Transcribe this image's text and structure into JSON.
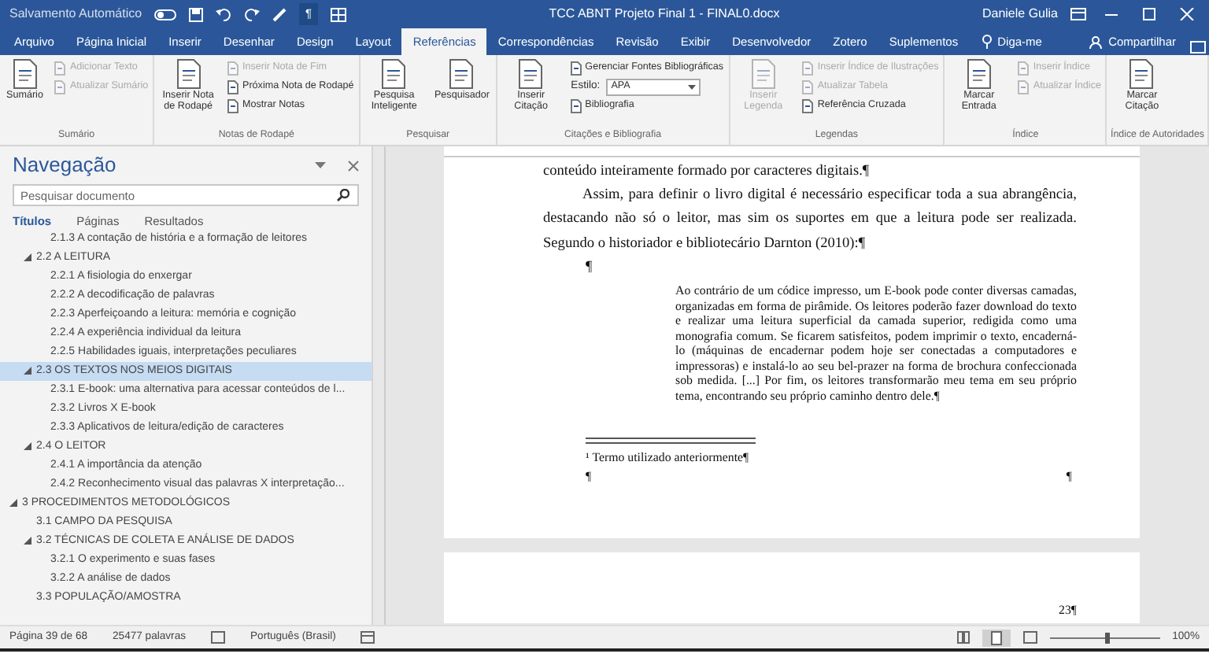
{
  "title_bar": {
    "autosave_label": "Salvamento Automático",
    "pilcrow": "¶",
    "title": "TCC ABNT Projeto Final 1 - FINAL0.docx",
    "user": "Daniele Gulia"
  },
  "ribbon_tabs": [
    {
      "label": "Arquivo",
      "selected": false
    },
    {
      "label": "Página Inicial",
      "selected": false
    },
    {
      "label": "Inserir",
      "selected": false
    },
    {
      "label": "Desenhar",
      "selected": false
    },
    {
      "label": "Design",
      "selected": false
    },
    {
      "label": "Layout",
      "selected": false
    },
    {
      "label": "Referências",
      "selected": true
    },
    {
      "label": "Correspondências",
      "selected": false
    },
    {
      "label": "Revisão",
      "selected": false
    },
    {
      "label": "Exibir",
      "selected": false
    },
    {
      "label": "Desenvolvedor",
      "selected": false
    },
    {
      "label": "Zotero",
      "selected": false
    },
    {
      "label": "Suplementos",
      "selected": false
    }
  ],
  "tell_me": "Diga-me",
  "share": "Compartilhar",
  "ribbon_groups": [
    {
      "name": "Sumário",
      "items": [
        {
          "kind": "large",
          "label": "Sumário",
          "disabled": false
        },
        {
          "kind": "small",
          "label": "Adicionar Texto",
          "disabled": true
        },
        {
          "kind": "small",
          "label": "Atualizar Sumário",
          "disabled": true
        }
      ]
    },
    {
      "name": "Notas de Rodapé",
      "items": [
        {
          "kind": "large",
          "label": "Inserir Nota de Rodapé",
          "disabled": false
        },
        {
          "kind": "small",
          "label": "Inserir Nota de Fim",
          "disabled": true
        },
        {
          "kind": "small",
          "label": "Próxima Nota de Rodapé",
          "disabled": false
        },
        {
          "kind": "small",
          "label": "Mostrar Notas",
          "disabled": false
        }
      ]
    },
    {
      "name": "Pesquisar",
      "items": [
        {
          "kind": "large",
          "label": "Pesquisa Inteligente",
          "disabled": false
        },
        {
          "kind": "large",
          "label": "Pesquisador",
          "disabled": false
        }
      ]
    },
    {
      "name": "Citações e Bibliografia",
      "items": [
        {
          "kind": "large",
          "label": "Inserir Citação",
          "disabled": false
        },
        {
          "kind": "small",
          "label": "Gerenciar Fontes Bibliográficas",
          "disabled": false
        },
        {
          "kind": "select",
          "label": "Estilo:",
          "value": "APA",
          "disabled": false
        },
        {
          "kind": "small",
          "label": "Bibliografia",
          "disabled": false
        }
      ]
    },
    {
      "name": "Legendas",
      "items": [
        {
          "kind": "large",
          "label": "Inserir Legenda",
          "disabled": true
        },
        {
          "kind": "small",
          "label": "Inserir Índice de Ilustrações",
          "disabled": true
        },
        {
          "kind": "small",
          "label": "Atualizar Tabela",
          "disabled": true
        },
        {
          "kind": "small",
          "label": "Referência Cruzada",
          "disabled": false
        }
      ]
    },
    {
      "name": "Índice",
      "items": [
        {
          "kind": "large",
          "label": "Marcar Entrada",
          "disabled": false
        },
        {
          "kind": "small",
          "label": "Inserir Índice",
          "disabled": true
        },
        {
          "kind": "small",
          "label": "Atualizar Índice",
          "disabled": true
        }
      ]
    },
    {
      "name": "Índice de Autoridades",
      "items": [
        {
          "kind": "large",
          "label": "Marcar Citação",
          "disabled": false
        }
      ]
    }
  ],
  "navigation": {
    "title": "Navegação",
    "search": {
      "placeholder": "Pesquisar documento"
    },
    "tabs": [
      {
        "label": "Títulos",
        "selected": true
      },
      {
        "label": "Páginas",
        "selected": false
      },
      {
        "label": "Resultados",
        "selected": false
      }
    ],
    "tree": [
      {
        "children": [
          {
            "children": [
              {
                "label": "2.1.3 A contação de história e a formação de leitores",
                "selected": false
              }
            ]
          },
          {
            "label": "2.2 A LEITURA",
            "selected": false,
            "expanded": true,
            "children": [
              {
                "label": "2.2.1 A fisiologia do enxergar",
                "selected": false
              },
              {
                "label": "2.2.2 A decodificação de palavras",
                "selected": false
              },
              {
                "label": "2.2.3 Aperfeiçoando a leitura: memória e cognição",
                "selected": false
              },
              {
                "label": "2.2.4 A experiência individual da leitura",
                "selected": false
              },
              {
                "label": "2.2.5 Habilidades iguais, interpretações peculiares",
                "selected": false
              }
            ]
          },
          {
            "label": "2.3 OS TEXTOS NOS MEIOS DIGITAIS",
            "selected": true,
            "expanded": true,
            "children": [
              {
                "label": "2.3.1 E-book: uma alternativa para acessar conteúdos de l...",
                "selected": false
              },
              {
                "label": "2.3.2 Livros X E-book",
                "selected": false
              },
              {
                "label": "2.3.3 Aplicativos de leitura/edição de caracteres",
                "selected": false
              }
            ]
          },
          {
            "label": "2.4 O LEITOR",
            "selected": false,
            "expanded": true,
            "children": [
              {
                "label": "2.4.1 A importância da atenção",
                "selected": false
              },
              {
                "label": "2.4.2 Reconhecimento visual das palavras X interpretação...",
                "selected": false
              }
            ]
          }
        ]
      },
      {
        "label": "3 PROCEDIMENTOS METODOLÓGICOS",
        "selected": false,
        "expanded": true,
        "children": [
          {
            "label": "3.1 CAMPO DA PESQUISA",
            "selected": false
          },
          {
            "label": "3.2 TÉCNICAS DE COLETA E ANÁLISE DE DADOS",
            "selected": false,
            "expanded": true,
            "children": [
              {
                "label": "3.2.1 O experimento e suas fases",
                "selected": false
              },
              {
                "label": "3.2.2 A análise de dados",
                "selected": false
              }
            ]
          },
          {
            "label": "3.3 POPULAÇÃO/AMOSTRA",
            "selected": false
          }
        ]
      }
    ]
  },
  "document": {
    "paragraphs": [
      {
        "kind": "body",
        "text": "conteúdo inteiramente formado por caracteres digitais.¶"
      },
      {
        "kind": "indented",
        "text": "Assim, para definir o livro digital é necessário especificar toda a sua abrangência, destacando não só o leitor, mas sim os suportes em que a leitura pode ser realizada. Segundo o historiador e bibliotecário Darnton (2010):¶"
      },
      {
        "kind": "mark",
        "text": "¶"
      },
      {
        "kind": "quote",
        "text": "Ao contrário de um códice impresso, um E-book pode conter diversas camadas, organizadas em forma de pirâmide. Os leitores poderão fazer download do texto e realizar uma leitura superficial da camada superior, redigida como uma monografia comum. Se ficarem satisfeitos, podem imprimir o texto, encaderná-lo (máquinas de encadernar podem hoje ser conectadas a computadores e impressoras) e instalá-lo ao seu bel-prazer na forma de brochura confeccionada sob medida. [...] Por fim, os leitores transformarão meu tema em seu próprio tema, encontrando seu próprio caminho dentro dele.¶"
      }
    ],
    "footnote": "¹ Termo utilizado anteriormente¶",
    "end_marks": [
      "¶",
      "¶"
    ],
    "next_page_number": "23¶"
  },
  "status_bar": {
    "page": "Página 39 de 68",
    "words": "25477 palavras",
    "language": "Português (Brasil)",
    "zoom": "100%",
    "zoom_slider": {
      "level": 0.5
    }
  }
}
